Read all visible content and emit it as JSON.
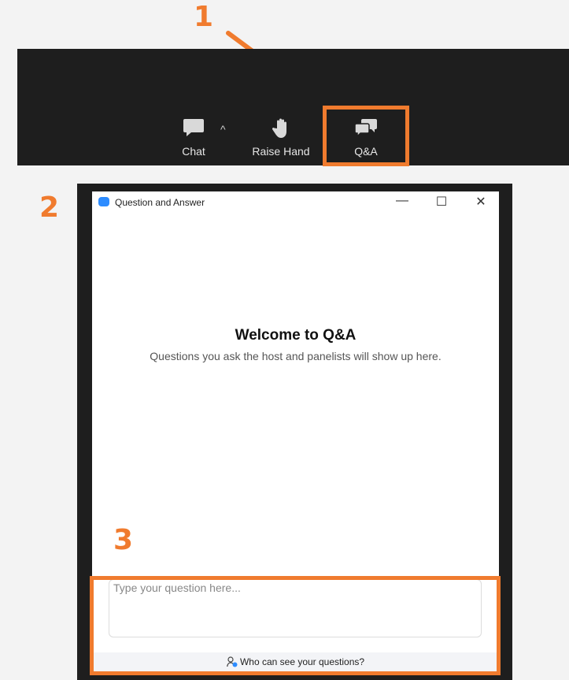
{
  "annotations": {
    "step1": "1",
    "step2": "2",
    "step3": "3",
    "color": "#f07b2e"
  },
  "toolbar": {
    "buttons": [
      {
        "label": "Chat",
        "icon": "chat-bubble-icon"
      },
      {
        "label": "Raise Hand",
        "icon": "raise-hand-icon"
      },
      {
        "label": "Q&A",
        "icon": "qa-bubbles-icon"
      }
    ],
    "chevron": "^"
  },
  "window": {
    "title": "Question and Answer",
    "controls": {
      "minimize": "—",
      "maximize": "☐",
      "close": "✕"
    },
    "welcome_title": "Welcome to Q&A",
    "welcome_body": "Questions you ask the host and panelists will show up here.",
    "input_placeholder": "Type your question here...",
    "footer_link": "Who can see your questions?"
  }
}
